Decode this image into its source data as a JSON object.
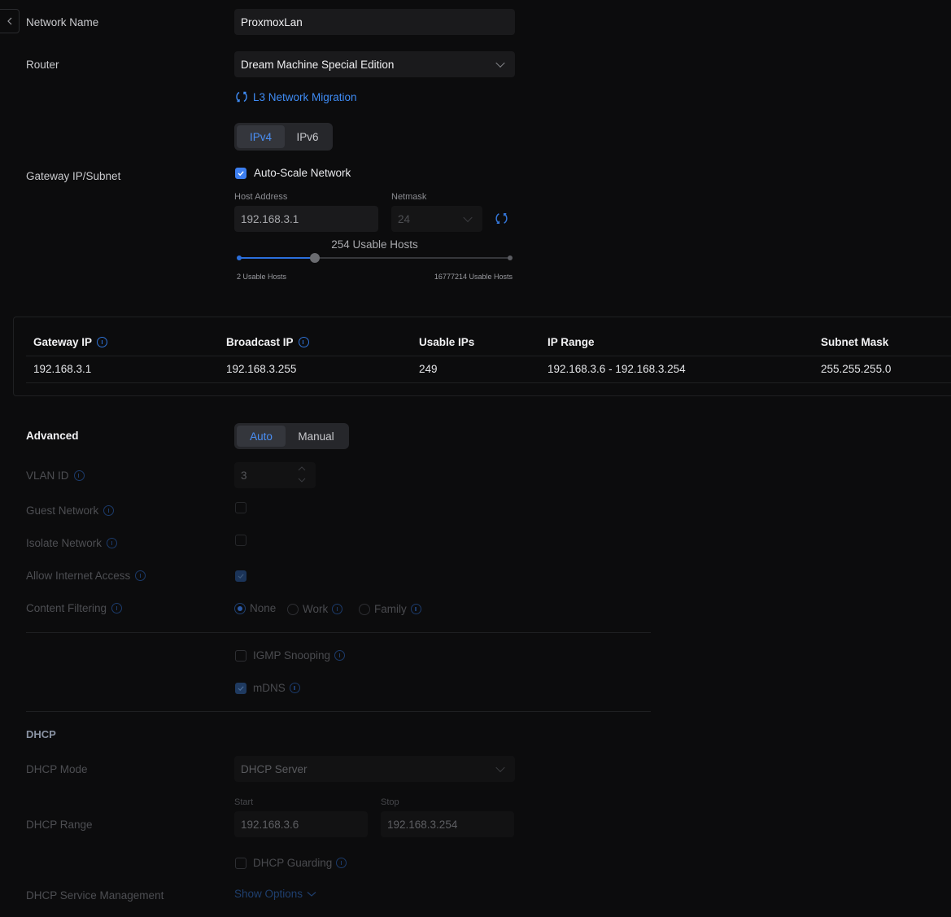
{
  "form": {
    "network_name": {
      "label": "Network Name",
      "value": "ProxmoxLan"
    },
    "router": {
      "label": "Router",
      "value": "Dream Machine Special Edition"
    },
    "l3_migration_link": "L3 Network Migration",
    "ip_version": {
      "options": [
        "IPv4",
        "IPv6"
      ],
      "selected": "IPv4"
    },
    "gateway": {
      "label": "Gateway IP/Subnet",
      "auto_scale": {
        "label": "Auto-Scale Network",
        "checked": true
      },
      "host_address": {
        "label": "Host Address",
        "value": "192.168.3.1"
      },
      "netmask": {
        "label": "Netmask",
        "value": "24"
      },
      "slider": {
        "value_label": "254 Usable Hosts",
        "min_label": "2 Usable Hosts",
        "max_label": "16777214 Usable Hosts",
        "position_fraction": 0.28
      }
    }
  },
  "summary_table": {
    "columns": [
      {
        "label": "Gateway IP",
        "info": true
      },
      {
        "label": "Broadcast IP",
        "info": true
      },
      {
        "label": "Usable IPs",
        "info": false
      },
      {
        "label": "IP Range",
        "info": false
      },
      {
        "label": "Subnet Mask",
        "info": false
      }
    ],
    "row": [
      "192.168.3.1",
      "192.168.3.255",
      "249",
      "192.168.3.6 - 192.168.3.254",
      "255.255.255.0"
    ]
  },
  "advanced": {
    "label": "Advanced",
    "mode": {
      "options": [
        "Auto",
        "Manual"
      ],
      "selected": "Auto"
    },
    "vlan_id": {
      "label": "VLAN ID",
      "value": "3"
    },
    "guest_network": {
      "label": "Guest Network",
      "checked": false
    },
    "isolate_network": {
      "label": "Isolate Network",
      "checked": false
    },
    "allow_internet": {
      "label": "Allow Internet Access",
      "checked": true
    },
    "content_filtering": {
      "label": "Content Filtering",
      "options": [
        "None",
        "Work",
        "Family"
      ],
      "selected": "None"
    },
    "igmp_snooping": {
      "label": "IGMP Snooping",
      "checked": false
    },
    "mdns": {
      "label": "mDNS",
      "checked": true
    }
  },
  "dhcp": {
    "section_title": "DHCP",
    "mode": {
      "label": "DHCP Mode",
      "value": "DHCP Server"
    },
    "range": {
      "label": "DHCP Range",
      "start_label": "Start",
      "start": "192.168.3.6",
      "stop_label": "Stop",
      "stop": "192.168.3.254"
    },
    "guarding": {
      "label": "DHCP Guarding",
      "checked": false
    },
    "service_management": {
      "label": "DHCP Service Management",
      "link": "Show Options"
    }
  },
  "colors": {
    "accent": "#3f8cf5",
    "background": "#0c0c0d",
    "input_bg": "#1a1a1c"
  }
}
